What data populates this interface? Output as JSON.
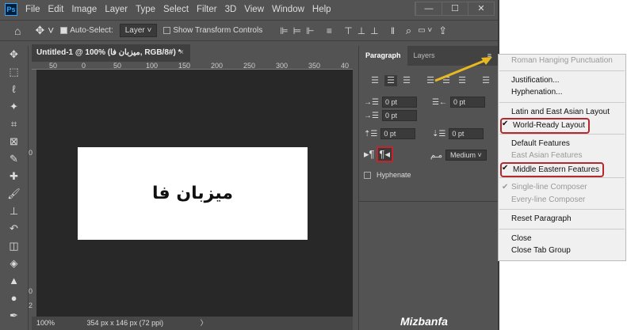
{
  "app": {
    "logo": "Ps",
    "menu": [
      "File",
      "Edit",
      "Image",
      "Layer",
      "Type",
      "Select",
      "Filter",
      "3D",
      "View",
      "Window",
      "Help"
    ],
    "window_controls": [
      "—",
      "☐",
      "✕"
    ]
  },
  "options": {
    "auto_select_label": "Auto-Select:",
    "auto_select_checked": true,
    "layer_select": "Layer",
    "show_transform_label": "Show Transform Controls",
    "show_transform_checked": false
  },
  "document": {
    "tab_title": "Untitled-1 @ 100% (میزبان فا, RGB/8#) *",
    "close": "×",
    "canvas_text": "میزبان فا",
    "ruler_ticks": [
      "50",
      "0",
      "50",
      "100",
      "150",
      "200",
      "250",
      "300",
      "350",
      "40"
    ],
    "vruler_ticks": [
      "0",
      "0",
      "2"
    ],
    "zoom": "100%",
    "info": "354 px x 146 px (72 ppi)",
    "info_arrow": "〉"
  },
  "panel": {
    "tabs": [
      "Paragraph",
      "Layers"
    ],
    "fields": {
      "indent_left": "0 pt",
      "indent_right": "0 pt",
      "indent_first": "0 pt",
      "space_before": "0 pt",
      "space_after": "0 pt"
    },
    "kashida": "Medium",
    "hyphenate_label": "Hyphenate",
    "hyphenate_checked": false
  },
  "flyout_menu": {
    "items": [
      {
        "label": "Roman Hanging Punctuation",
        "disabled": true
      },
      {
        "sep": true
      },
      {
        "label": "Justification..."
      },
      {
        "label": "Hyphenation..."
      },
      {
        "sep": true
      },
      {
        "label": "Latin and East Asian Layout"
      },
      {
        "label": "World-Ready Layout",
        "checked": true,
        "highlight": true
      },
      {
        "sep": true
      },
      {
        "label": "Default Features"
      },
      {
        "label": "East Asian Features",
        "disabled": true
      },
      {
        "label": "Middle Eastern Features",
        "checked": true,
        "highlight": true
      },
      {
        "sep": true
      },
      {
        "label": "Single-line Composer",
        "checked": true,
        "disabled": true
      },
      {
        "label": "Every-line Composer",
        "disabled": true
      },
      {
        "sep": true
      },
      {
        "label": "Reset Paragraph"
      },
      {
        "sep": true
      },
      {
        "label": "Close"
      },
      {
        "label": "Close Tab Group"
      }
    ]
  },
  "watermark": "Mizbanfa",
  "colors": {
    "highlight": "#c0272d",
    "arrow": "#e8b820"
  }
}
